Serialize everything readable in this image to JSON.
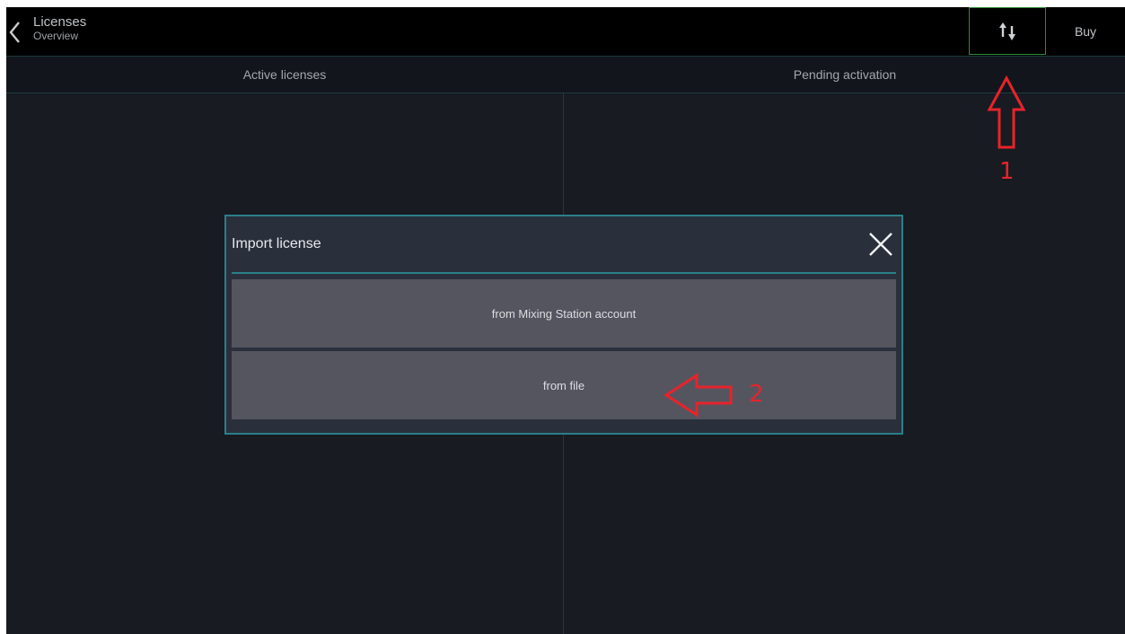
{
  "header": {
    "title": "Licenses",
    "subtitle": "Overview",
    "back_icon": "chevron-left-icon",
    "import_icon": "import-export-arrows-icon",
    "buy_label": "Buy"
  },
  "columns": {
    "active_label": "Active licenses",
    "pending_label": "Pending activation"
  },
  "dialog": {
    "title": "Import license",
    "close_icon": "close-icon",
    "options": [
      {
        "label": "from Mixing Station account"
      },
      {
        "label": "from file"
      }
    ]
  },
  "annotations": [
    {
      "label": "1",
      "icon": "red-up-arrow-icon"
    },
    {
      "label": "2",
      "icon": "red-left-arrow-icon"
    }
  ],
  "colors": {
    "background": "#181b22",
    "topbar": "#000000",
    "accent": "#2b7f88",
    "active_border": "#2f8c36",
    "annotation": "#e8232a",
    "option_bg": "#555560",
    "dialog_bg": "#2a2f3c"
  }
}
